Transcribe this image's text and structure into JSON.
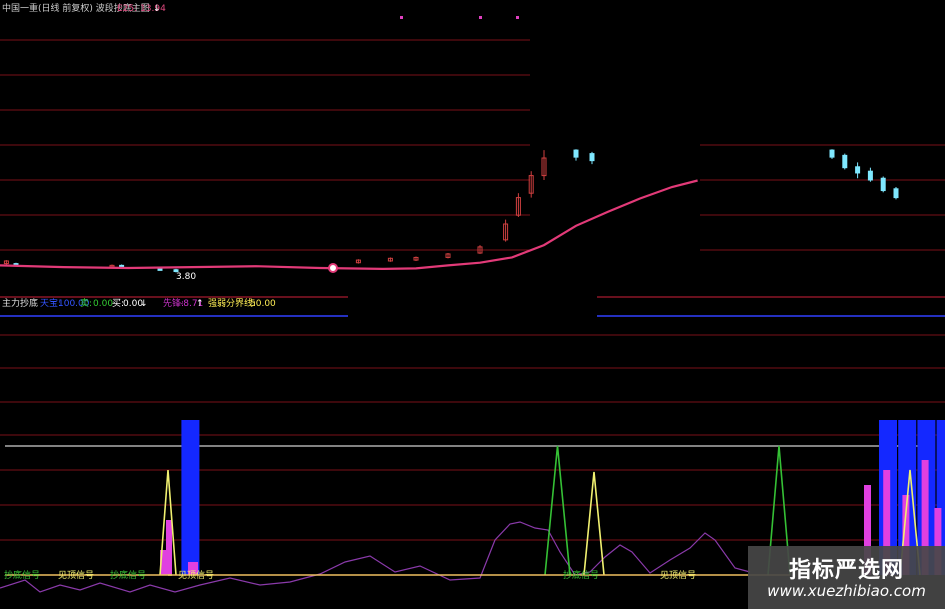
{
  "top_panel": {
    "title": "中国一重(日线 前复权) 波段抄底主图",
    "indicator_label": "E25: 13.94",
    "indicator_arrow": "↓",
    "low_marker": "3.80"
  },
  "sub_panel": {
    "title": "主力抄底",
    "items": [
      {
        "label": "天宝:",
        "value": "100.00",
        "color": "#3355ff"
      },
      {
        "label": "卖:",
        "value": "0.00",
        "color": "#33cc33"
      },
      {
        "label": "买:",
        "value": "0.00",
        "color": "#ffffff"
      },
      {
        "label": "↓",
        "value": "",
        "color": "#ffffff"
      },
      {
        "label": "先锋:",
        "value": "-8.71",
        "color": "#cc33cc"
      },
      {
        "label": "↑",
        "value": "",
        "color": "#ffffff"
      },
      {
        "label": "强弱分界线:",
        "value": "50.00",
        "color": "#ffee55"
      }
    ]
  },
  "bottom_labels": [
    "抄底信号",
    "见顶信号",
    "抄底信号",
    "抄底信号",
    "见顶信号",
    "见顶信号"
  ],
  "watermark": {
    "cn": "指标严选网",
    "url": "www.xuezhibiao.com"
  },
  "colors": {
    "ma": "#e23a78",
    "grid": "#7a1018",
    "threshold": "#cfcfcf",
    "bar_blue": "#1428ff",
    "bar_magenta": "#e040e0",
    "line_green": "#35c035",
    "line_yellow": "#f0f070",
    "line_purple": "#8a3aaa",
    "baseline": "#f0c060",
    "candle_up": "#d04040",
    "candle_down": "#7fe8ff"
  },
  "chart_data": [
    {
      "type": "candlestick",
      "title": "中国一重(日线 前复权) 波段抄底主图",
      "legend": "E25: 13.94",
      "ma_label": "E25",
      "ma_value_last": 13.94,
      "min_label": 3.8,
      "ma": [
        {
          "x": 0,
          "y": 4.3
        },
        {
          "x": 20,
          "y": 4.1
        },
        {
          "x": 40,
          "y": 4.0
        },
        {
          "x": 60,
          "y": 4.1
        },
        {
          "x": 80,
          "y": 4.2
        },
        {
          "x": 100,
          "y": 4.0
        },
        {
          "x": 120,
          "y": 3.9
        },
        {
          "x": 130,
          "y": 3.95
        },
        {
          "x": 140,
          "y": 4.3
        },
        {
          "x": 150,
          "y": 4.6
        },
        {
          "x": 160,
          "y": 5.2
        },
        {
          "x": 170,
          "y": 6.6
        },
        {
          "x": 180,
          "y": 8.8
        },
        {
          "x": 190,
          "y": 10.4
        },
        {
          "x": 200,
          "y": 11.9
        },
        {
          "x": 210,
          "y": 13.2
        },
        {
          "x": 218,
          "y": 13.94
        }
      ],
      "candles": [
        {
          "x": 2,
          "o": 4.5,
          "c": 4.8,
          "h": 4.9,
          "l": 4.4
        },
        {
          "x": 5,
          "o": 4.5,
          "c": 4.3,
          "h": 4.6,
          "l": 4.2
        },
        {
          "x": 35,
          "o": 4.2,
          "c": 4.3,
          "h": 4.4,
          "l": 4.1
        },
        {
          "x": 38,
          "o": 4.3,
          "c": 4.2,
          "h": 4.4,
          "l": 4.1
        },
        {
          "x": 50,
          "o": 3.9,
          "c": 3.8,
          "h": 4.0,
          "l": 3.8
        },
        {
          "x": 55,
          "o": 3.8,
          "c": 3.6,
          "h": 3.9,
          "l": 3.5
        },
        {
          "x": 112,
          "o": 4.6,
          "c": 4.9,
          "h": 5.0,
          "l": 4.5
        },
        {
          "x": 122,
          "o": 4.8,
          "c": 5.1,
          "h": 5.2,
          "l": 4.7
        },
        {
          "x": 130,
          "o": 4.9,
          "c": 5.2,
          "h": 5.3,
          "l": 4.8
        },
        {
          "x": 140,
          "o": 5.2,
          "c": 5.6,
          "h": 5.7,
          "l": 5.1
        },
        {
          "x": 150,
          "o": 5.7,
          "c": 6.4,
          "h": 6.6,
          "l": 5.6
        },
        {
          "x": 158,
          "o": 7.2,
          "c": 9.0,
          "h": 9.5,
          "l": 7.0
        },
        {
          "x": 162,
          "o": 10.0,
          "c": 12.0,
          "h": 12.5,
          "l": 9.8
        },
        {
          "x": 166,
          "o": 12.5,
          "c": 14.5,
          "h": 15.0,
          "l": 12.0
        },
        {
          "x": 170,
          "o": 14.5,
          "c": 16.5,
          "h": 17.4,
          "l": 14.0
        },
        {
          "x": 180,
          "o": 17.4,
          "c": 16.6,
          "h": 17.5,
          "l": 16.2
        },
        {
          "x": 185,
          "o": 17.0,
          "c": 16.2,
          "h": 17.2,
          "l": 15.8
        },
        {
          "x": 260,
          "o": 17.4,
          "c": 16.6,
          "h": 17.5,
          "l": 16.4
        },
        {
          "x": 264,
          "o": 16.8,
          "c": 15.4,
          "h": 17.0,
          "l": 15.2
        },
        {
          "x": 268,
          "o": 15.5,
          "c": 14.8,
          "h": 16.0,
          "l": 14.2
        },
        {
          "x": 272,
          "o": 15.0,
          "c": 14.0,
          "h": 15.4,
          "l": 13.8
        },
        {
          "x": 276,
          "o": 14.2,
          "c": 12.8,
          "h": 14.4,
          "l": 12.6
        },
        {
          "x": 280,
          "o": 13.0,
          "c": 12.0,
          "h": 13.2,
          "l": 11.8
        }
      ]
    },
    {
      "type": "line",
      "title": "主力抄底",
      "threshold": 100,
      "strength_line": 50,
      "series": [
        {
          "name": "天宝",
          "last": 100.0,
          "bars_full": [
            57,
            275,
            281,
            287,
            293
          ]
        },
        {
          "name": "卖",
          "last": 0.0,
          "spikes": [
            175,
            246
          ]
        },
        {
          "name": "买",
          "last": 0.0,
          "spikes": [
            186
          ]
        },
        {
          "name": "先锋",
          "last": -8.71
        },
        {
          "name": "强弱分界线",
          "last": 50.0
        }
      ]
    }
  ]
}
